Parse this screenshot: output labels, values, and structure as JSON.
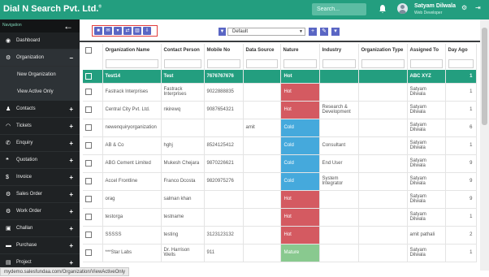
{
  "app": {
    "brand": "Dial N Search Pvt. Ltd.",
    "brand_mark": "®"
  },
  "header": {
    "search_placeholder": "Search...",
    "user_name": "Satyam Dilwala",
    "user_role": "Web Developer",
    "colors": {
      "topbar": "#239e7f",
      "accent": "#5a66c4"
    }
  },
  "sidebar": {
    "title": "Navigation",
    "items": [
      {
        "label": "Dashboard",
        "icon": "dashboard-icon",
        "glyph": "◉",
        "expand": ""
      },
      {
        "label": "Organization",
        "icon": "organization-icon",
        "glyph": "⚙",
        "expand": "−"
      },
      {
        "label": "New Organization",
        "sub": true
      },
      {
        "label": "View Active Only",
        "sub": true
      },
      {
        "label": "Contacts",
        "icon": "contacts-icon",
        "glyph": "♟",
        "expand": "+"
      },
      {
        "label": "Tickets",
        "icon": "headset-icon",
        "glyph": "◠",
        "expand": "+"
      },
      {
        "label": "Enquiry",
        "icon": "phone-icon",
        "glyph": "✆",
        "expand": "+"
      },
      {
        "label": "Quotation",
        "icon": "quote-icon",
        "glyph": "❝",
        "expand": "+"
      },
      {
        "label": "Invoice",
        "icon": "dollar-icon",
        "glyph": "$",
        "expand": "+"
      },
      {
        "label": "Sales Order",
        "icon": "sales-icon",
        "glyph": "⚙",
        "expand": "+"
      },
      {
        "label": "Work Order",
        "icon": "work-icon",
        "glyph": "⚙",
        "expand": "+"
      },
      {
        "label": "Challan",
        "icon": "truck-icon",
        "glyph": "▣",
        "expand": "+"
      },
      {
        "label": "Purchase",
        "icon": "cart-icon",
        "glyph": "▬",
        "expand": "+"
      },
      {
        "label": "Project",
        "icon": "project-icon",
        "glyph": "▤",
        "expand": "+"
      }
    ]
  },
  "toolbar": {
    "view": "Default"
  },
  "table": {
    "columns": [
      "Organization Name",
      "Contact Person",
      "Mobile No",
      "Data Source",
      "Nature",
      "Industry",
      "Organization Type",
      "Assigned To",
      "Day Ago"
    ],
    "rows": [
      {
        "org": "Test14",
        "contact": "Test",
        "mobile": "7676767676",
        "source": "",
        "nature": "Hot",
        "industry": "",
        "type": "",
        "assigned": "ABC XYZ",
        "days": "1",
        "selected": true
      },
      {
        "org": "Fastrack Interprises",
        "contact": "Fastrack Interprises",
        "mobile": "9022888835",
        "source": "",
        "nature": "Hot",
        "industry": "",
        "type": "",
        "assigned": "Satyam Dilwala",
        "days": "1"
      },
      {
        "org": "Central City Pvt. Ltd.",
        "contact": "nkirewq",
        "mobile": "9087654321",
        "source": "",
        "nature": "Hot",
        "industry": "Research & Development",
        "type": "",
        "assigned": "Satyam Dilwala",
        "days": "1"
      },
      {
        "org": "newenquiryorganization",
        "contact": "",
        "mobile": "",
        "source": "amit",
        "nature": "Cold",
        "industry": "",
        "type": "",
        "assigned": "Satyam Dilwala",
        "days": "6"
      },
      {
        "org": "AB & Co",
        "contact": "hghj",
        "mobile": "8524125412",
        "source": "",
        "nature": "Cold",
        "industry": "Consultant",
        "type": "",
        "assigned": "Satyam Dilwala",
        "days": "1"
      },
      {
        "org": "ABG Cement Limited",
        "contact": "Mukesh Chejara",
        "mobile": "9870226621",
        "source": "",
        "nature": "Cold",
        "industry": "End User",
        "type": "",
        "assigned": "Satyam Dilwala",
        "days": "9"
      },
      {
        "org": "Accel Frontline",
        "contact": "Franco Dcosta",
        "mobile": "9820975276",
        "source": "",
        "nature": "Cold",
        "industry": "System Integrator",
        "type": "",
        "assigned": "Satyam Dilwala",
        "days": "9"
      },
      {
        "org": "orag",
        "contact": "salman khan",
        "mobile": "",
        "source": "",
        "nature": "Hot",
        "industry": "",
        "type": "",
        "assigned": "Satyam Dilwala",
        "days": "9"
      },
      {
        "org": "testorga",
        "contact": "testname",
        "mobile": "",
        "source": "",
        "nature": "Hot",
        "industry": "",
        "type": "",
        "assigned": "Satyam Dilwala",
        "days": "1"
      },
      {
        "org": "SSSSS",
        "contact": "testing",
        "mobile": "3123123132",
        "source": "",
        "nature": "Hot",
        "industry": "",
        "type": "",
        "assigned": "amit pathali",
        "days": "2"
      },
      {
        "org": "***Star Labs",
        "contact": "Dr. Harrison Wells",
        "mobile": "911",
        "source": "",
        "nature": "Mature",
        "industry": "",
        "type": "",
        "assigned": "Satyam Dilwala",
        "days": "1"
      }
    ]
  },
  "statusbar": {
    "url": "mydemo.salesfundaa.com/Organization/ViewActiveOnly"
  }
}
